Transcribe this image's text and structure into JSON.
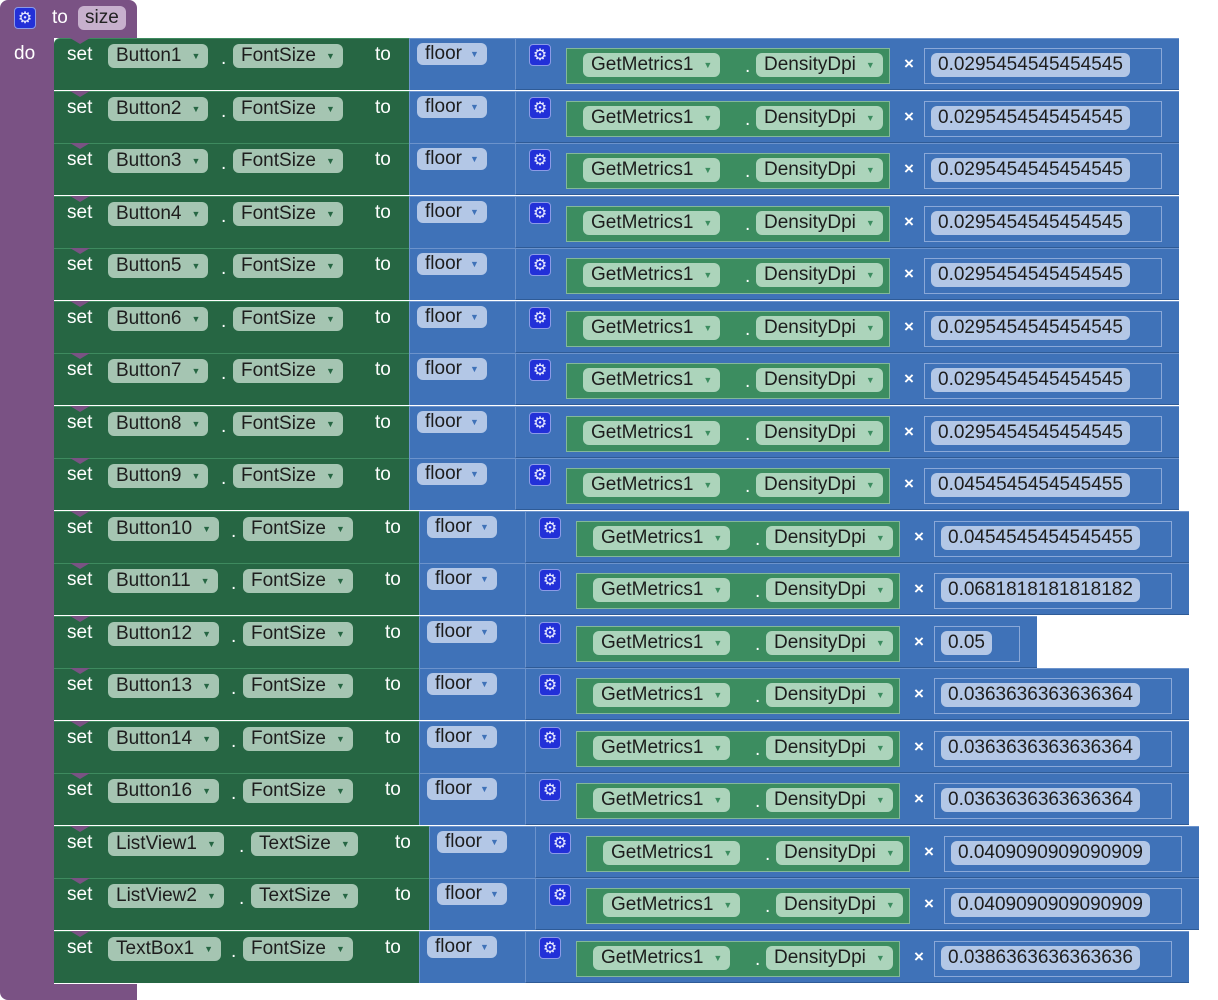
{
  "procedure": {
    "to_label": "to",
    "name": "size",
    "do_label": "do",
    "icon": "gear-icon"
  },
  "labels": {
    "set": "set",
    "to": "to",
    "dot": ".",
    "floor": "floor",
    "times": "×",
    "get_component": "GetMetrics1",
    "get_property": "DensityDpi"
  },
  "rows": [
    {
      "component": "Button1",
      "property": "FontSize",
      "factor": "0.0295454545454545"
    },
    {
      "component": "Button2",
      "property": "FontSize",
      "factor": "0.0295454545454545"
    },
    {
      "component": "Button3",
      "property": "FontSize",
      "factor": "0.0295454545454545"
    },
    {
      "component": "Button4",
      "property": "FontSize",
      "factor": "0.0295454545454545"
    },
    {
      "component": "Button5",
      "property": "FontSize",
      "factor": "0.0295454545454545"
    },
    {
      "component": "Button6",
      "property": "FontSize",
      "factor": "0.0295454545454545"
    },
    {
      "component": "Button7",
      "property": "FontSize",
      "factor": "0.0295454545454545"
    },
    {
      "component": "Button8",
      "property": "FontSize",
      "factor": "0.0295454545454545"
    },
    {
      "component": "Button9",
      "property": "FontSize",
      "factor": "0.0454545454545455"
    },
    {
      "component": "Button10",
      "property": "FontSize",
      "factor": "0.0454545454545455"
    },
    {
      "component": "Button11",
      "property": "FontSize",
      "factor": "0.0681818181818182"
    },
    {
      "component": "Button12",
      "property": "FontSize",
      "factor": "0.05"
    },
    {
      "component": "Button13",
      "property": "FontSize",
      "factor": "0.0363636363636364"
    },
    {
      "component": "Button14",
      "property": "FontSize",
      "factor": "0.0363636363636364"
    },
    {
      "component": "Button16",
      "property": "FontSize",
      "factor": "0.0363636363636364"
    },
    {
      "component": "ListView1",
      "property": "TextSize",
      "factor": "0.0409090909090909"
    },
    {
      "component": "ListView2",
      "property": "TextSize",
      "factor": "0.0409090909090909"
    },
    {
      "component": "TextBox1",
      "property": "FontSize",
      "factor": "0.0386363636363636"
    }
  ]
}
